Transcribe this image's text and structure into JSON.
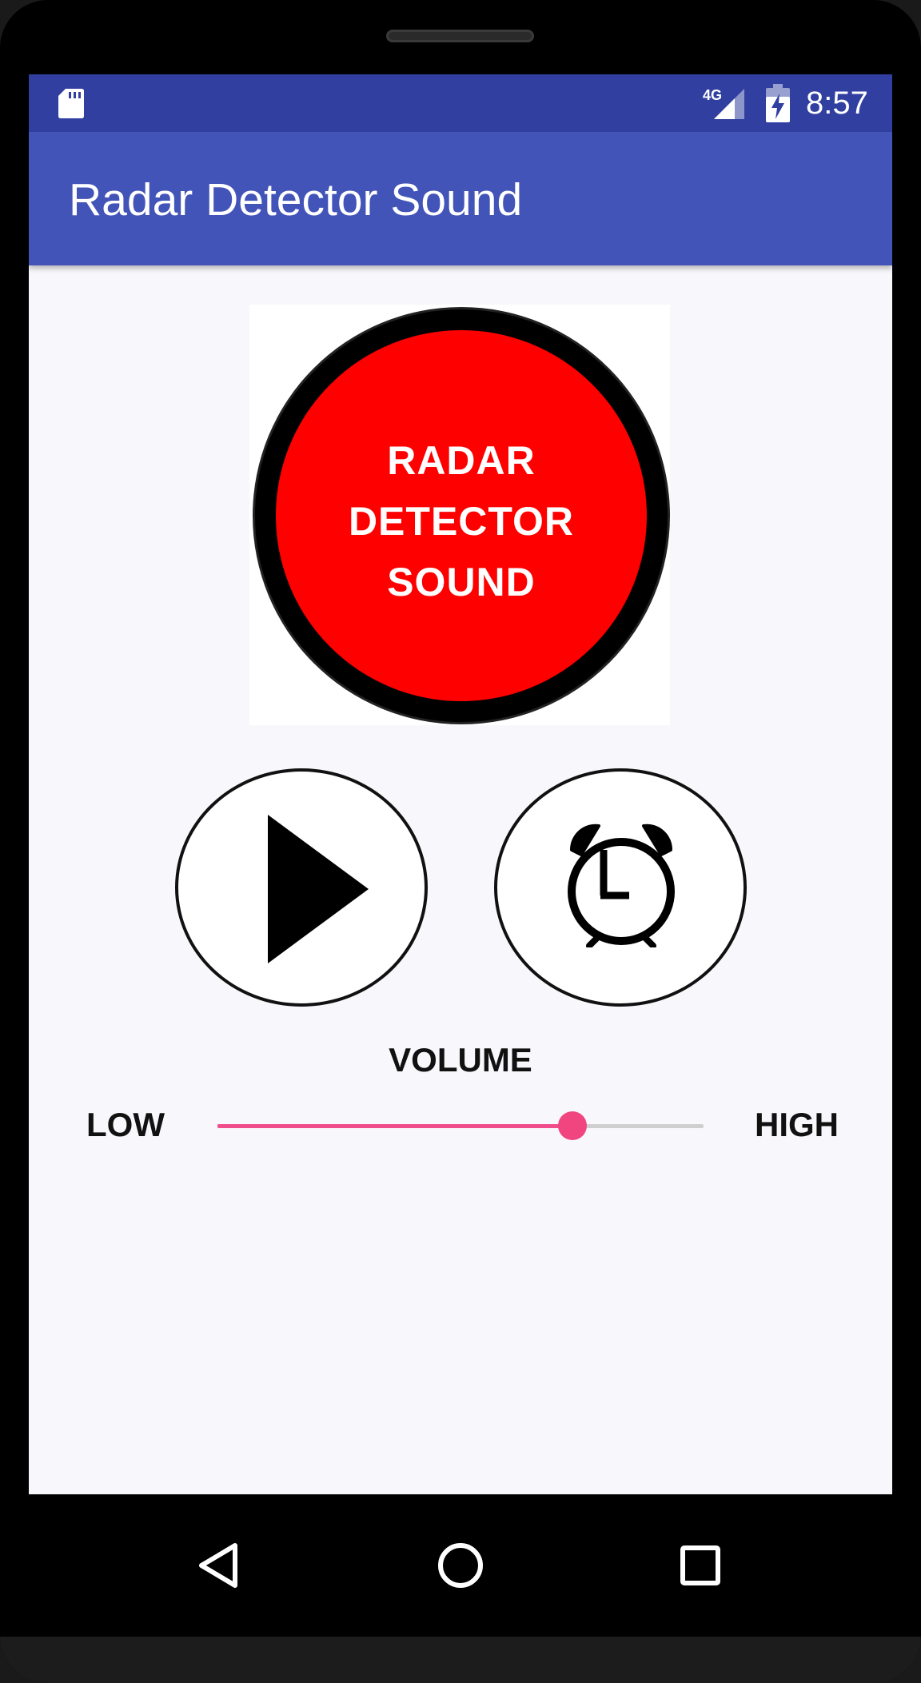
{
  "status_bar": {
    "time": "8:57",
    "network": "4G",
    "icons": [
      "sd-card-icon",
      "signal-4g-icon",
      "battery-charging-icon"
    ],
    "background": "#3140a0"
  },
  "app_bar": {
    "title": "Radar Detector Sound",
    "background": "#4254b7"
  },
  "logo": {
    "lines": [
      "RADAR",
      "DETECTOR",
      "SOUND"
    ],
    "color": "#ff0000"
  },
  "buttons": {
    "play_icon": "play-icon",
    "timer_icon": "alarm-clock-icon"
  },
  "volume": {
    "label": "VOLUME",
    "low_label": "LOW",
    "high_label": "HIGH",
    "level": 0.73,
    "accent": "#ef4d8c"
  },
  "nav_bar": {
    "icons": [
      "back-icon",
      "home-icon",
      "recent-apps-icon"
    ]
  }
}
